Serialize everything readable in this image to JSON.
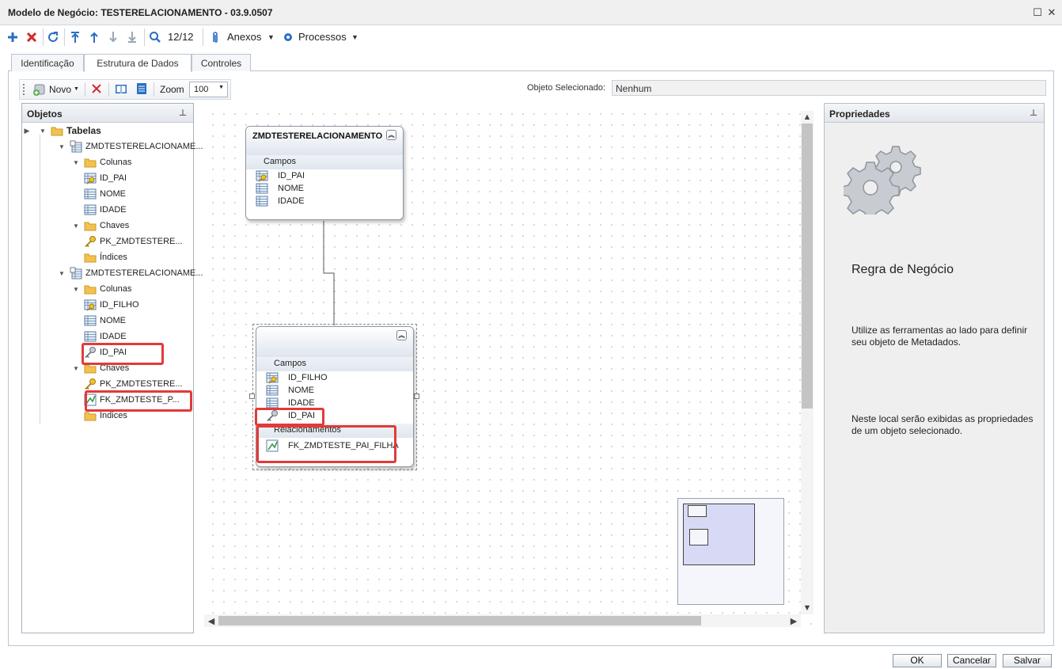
{
  "window": {
    "title": "Modelo de Negócio: TESTERELACIONAMENTO - 03.9.0507"
  },
  "toolbar": {
    "record_counter": "12/12",
    "attachments_label": "Anexos",
    "processes_label": "Processos"
  },
  "tabs": [
    {
      "label": "Identificação"
    },
    {
      "label": "Estrutura de Dados"
    },
    {
      "label": "Controles"
    }
  ],
  "designer_toolbar": {
    "new_label": "Novo",
    "zoom_label": "Zoom",
    "zoom_value": "100"
  },
  "selection": {
    "label": "Objeto Selecionado:",
    "value": "Nenhum"
  },
  "objects_panel": {
    "title": "Objetos",
    "tree": [
      {
        "label": "Tabelas",
        "icon": "folder-icon",
        "level": 1
      },
      {
        "label": "ZMDTESTERELACIONAME...",
        "icon": "table-icon",
        "level": 2
      },
      {
        "label": "Colunas",
        "icon": "folder-icon",
        "level": 3
      },
      {
        "label": "ID_PAI",
        "icon": "pk-field-icon",
        "level": 4
      },
      {
        "label": "NOME",
        "icon": "field-icon",
        "level": 4
      },
      {
        "label": "IDADE",
        "icon": "field-icon",
        "level": 4
      },
      {
        "label": "Chaves",
        "icon": "folder-icon",
        "level": 3
      },
      {
        "label": "PK_ZMDTESTERE...",
        "icon": "key-icon",
        "level": 4
      },
      {
        "label": "Índices",
        "icon": "folder-icon",
        "level": 3
      },
      {
        "label": "ZMDTESTERELACIONAME...",
        "icon": "table-icon",
        "level": 2
      },
      {
        "label": "Colunas",
        "icon": "folder-icon",
        "level": 3
      },
      {
        "label": "ID_FILHO",
        "icon": "pk-field-icon",
        "level": 4
      },
      {
        "label": "NOME",
        "icon": "field-icon",
        "level": 4
      },
      {
        "label": "IDADE",
        "icon": "field-icon",
        "level": 4
      },
      {
        "label": "ID_PAI",
        "icon": "fk-key-icon",
        "level": 4
      },
      {
        "label": "Chaves",
        "icon": "folder-icon",
        "level": 3
      },
      {
        "label": "PK_ZMDTESTERE...",
        "icon": "key-icon",
        "level": 4
      },
      {
        "label": "FK_ZMDTESTE_P...",
        "icon": "relation-icon",
        "level": 4
      },
      {
        "label": "Índices",
        "icon": "folder-icon",
        "level": 3
      }
    ]
  },
  "entity_parent": {
    "title": "ZMDTESTERELACIONAMENTO",
    "section_fields": "Campos",
    "fields": [
      "ID_PAI",
      "NOME",
      "IDADE"
    ]
  },
  "entity_child": {
    "title": "",
    "section_fields": "Campos",
    "fields": [
      "ID_FILHO",
      "NOME",
      "IDADE",
      "ID_PAI"
    ],
    "section_relations": "Relacionamentos",
    "relations": [
      "FK_ZMDTESTE_PAI_FILHA"
    ]
  },
  "properties_panel": {
    "title": "Propriedades",
    "heading": "Regra de Negócio",
    "text1": "Utilize as ferramentas ao lado para definir seu objeto de Metadados.",
    "text2": "Neste local serão exibidas as propriedades de um objeto selecionado."
  },
  "buttons": {
    "ok": "OK",
    "cancel": "Cancelar",
    "save": "Salvar"
  },
  "colors": {
    "accent_blue": "#2a6fc0",
    "highlight_red": "#e23a3a",
    "delete_red": "#d22b2b"
  }
}
